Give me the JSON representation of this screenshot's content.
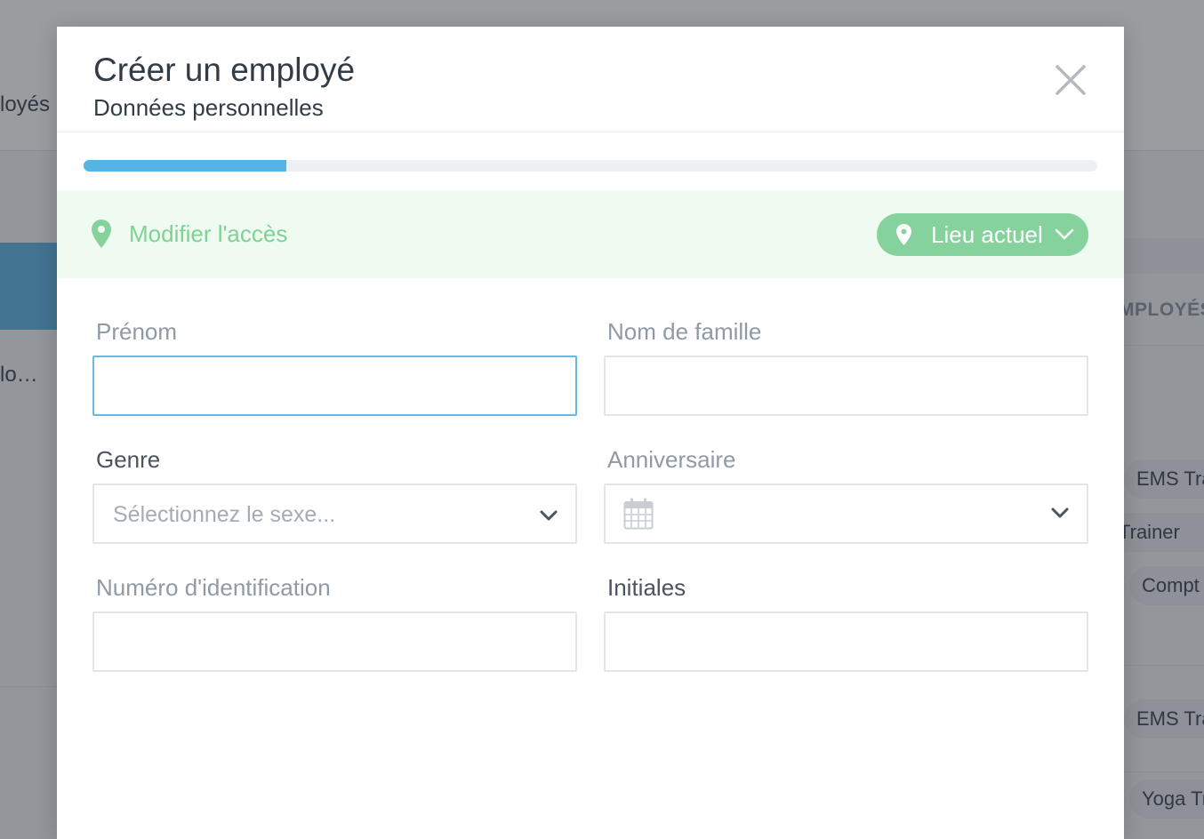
{
  "background": {
    "nav_partial": "loyés",
    "list_item_partial": "lo…",
    "column_header_partial": "MPLOYÉS",
    "pills": [
      "EMS Tra",
      "Trainer",
      "Compt",
      "EMS Tra",
      "Yoga Tr"
    ]
  },
  "modal": {
    "title": "Créer un employé",
    "subtitle": "Données personnelles",
    "progress_fraction": 0.2,
    "access": {
      "text": "Modifier l'accès",
      "location_button": "Lieu actuel"
    },
    "fields": {
      "first_name": {
        "label": "Prénom",
        "value": ""
      },
      "last_name": {
        "label": "Nom de famille",
        "value": ""
      },
      "gender": {
        "label": "Genre",
        "placeholder": "Sélectionnez le sexe..."
      },
      "birthday": {
        "label": "Anniversaire",
        "value": ""
      },
      "id_number": {
        "label": "Numéro d'identification",
        "value": ""
      },
      "initials": {
        "label": "Initiales",
        "value": ""
      }
    }
  },
  "colors": {
    "accent_blue": "#55b4e4",
    "success_green": "#86d29d",
    "access_bg": "#effaf1"
  },
  "icons": {
    "close": "close-icon",
    "pin": "map-pin-icon",
    "chevron": "chevron-down-icon",
    "calendar": "calendar-icon"
  }
}
